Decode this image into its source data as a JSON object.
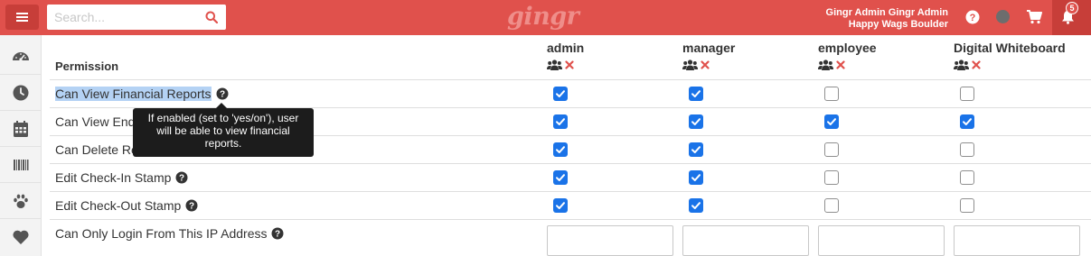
{
  "header": {
    "search_placeholder": "Search...",
    "logo": "gingr",
    "user_name": "Gingr Admin Gingr Admin",
    "location": "Happy Wags Boulder",
    "notification_count": "5",
    "accent_color": "#e0514c"
  },
  "sidebar": {
    "items": [
      "dashboard-icon",
      "clock-icon",
      "calendar-icon",
      "barcode-icon",
      "paw-icon",
      "heart-icon"
    ]
  },
  "table": {
    "permission_header": "Permission",
    "columns": [
      {
        "name": "admin"
      },
      {
        "name": "manager"
      },
      {
        "name": "employee"
      },
      {
        "name": "Digital Whiteboard"
      }
    ],
    "rows": [
      {
        "label": "Can View Financial Reports",
        "values": [
          true,
          true,
          false,
          false
        ]
      },
      {
        "label": "Can View End of Day Reports",
        "values": [
          true,
          true,
          true,
          true
        ]
      },
      {
        "label": "Can Delete Reservations",
        "values": [
          true,
          true,
          false,
          false
        ]
      },
      {
        "label": "Edit Check-In Stamp",
        "values": [
          true,
          true,
          false,
          false
        ]
      },
      {
        "label": "Edit Check-Out Stamp",
        "values": [
          true,
          true,
          false,
          false
        ]
      },
      {
        "label": "Can Only Login From This IP Address",
        "values": [
          "",
          "",
          "",
          ""
        ]
      }
    ]
  },
  "tooltip": {
    "text": "If enabled (set to 'yes/on'), user will be able to view financial reports."
  }
}
